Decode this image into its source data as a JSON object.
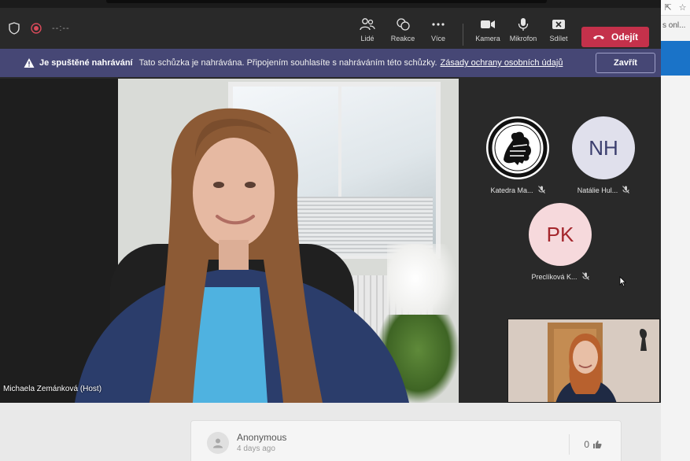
{
  "browser": {
    "tab_fragment": "s onl...",
    "toolbar_glyphs": [
      "⇱",
      "☆"
    ]
  },
  "toolbar": {
    "timer": "--:--",
    "people_label": "Lidé",
    "reactions_label": "Reakce",
    "more_label": "Více",
    "camera_label": "Kamera",
    "mic_label": "Mikrofon",
    "share_label": "Sdílet",
    "leave_label": "Odejít"
  },
  "banner": {
    "title": "Je spuštěné nahrávání",
    "text": "Tato schůzka je nahrávána. Připojením souhlasíte s nahráváním této schůzky.",
    "link": "Zásady ochrany osobních údajů",
    "close_label": "Zavřít"
  },
  "main_video": {
    "participant_label": "Michaela Zemánková (Host)"
  },
  "participants": [
    {
      "name": "Katedra Ma...",
      "initials": ""
    },
    {
      "name": "Natálie Hul...",
      "initials": "NH"
    },
    {
      "name": "Preclíková K...",
      "initials": "PK"
    }
  ],
  "comment": {
    "author": "Anonymous",
    "time": "4 days ago",
    "likes": "0"
  },
  "colors": {
    "teams_bg": "#292929",
    "banner_bg": "#464775",
    "leave_red": "#c4314b",
    "nh_avatar": "#e0e0ec",
    "pk_avatar": "#f6d9dc"
  }
}
